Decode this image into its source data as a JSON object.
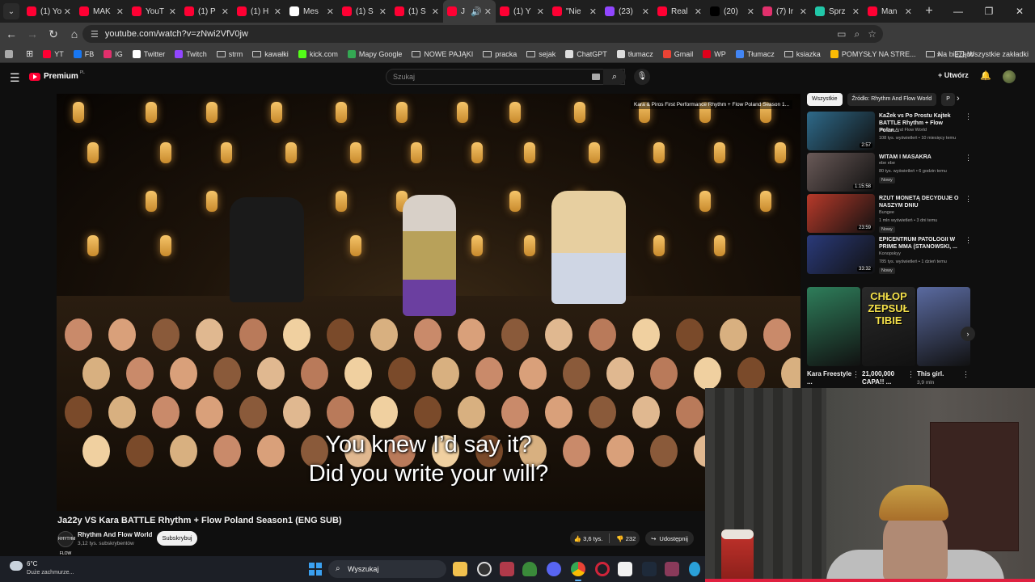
{
  "browser": {
    "tabs": [
      {
        "title": "(1) Yo",
        "color": "#ff0033"
      },
      {
        "title": "MAK",
        "color": "#ff0033"
      },
      {
        "title": "YouT",
        "color": "#ff0033"
      },
      {
        "title": "(1) P",
        "color": "#ff0033"
      },
      {
        "title": "(1) H",
        "color": "#ff0033"
      },
      {
        "title": "Mes",
        "color": "#ffffff"
      },
      {
        "title": "(1) S",
        "color": "#ff0033"
      },
      {
        "title": "(1) S",
        "color": "#ff0033"
      },
      {
        "title": "J",
        "color": "#ff0033",
        "active": true
      },
      {
        "title": "(1) Y",
        "color": "#ff0033"
      },
      {
        "title": "\"Nie",
        "color": "#ff0033"
      },
      {
        "title": "(23)",
        "color": "#9146ff"
      },
      {
        "title": "Real",
        "color": "#ff0033"
      },
      {
        "title": "(20)",
        "color": "#000000"
      },
      {
        "title": "(7) Ir",
        "color": "#e1306c"
      },
      {
        "title": "Sprz",
        "color": "#21c7a8"
      },
      {
        "title": "Man",
        "color": "#ff0033"
      }
    ],
    "url": "youtube.com/watch?v=zNwi2VfV0jw",
    "bookmarks": [
      {
        "label": "YT",
        "icon": "youtube-icon",
        "color": "#ff0033"
      },
      {
        "label": "FB",
        "icon": "facebook-icon",
        "color": "#1877f2"
      },
      {
        "label": "IG",
        "icon": "instagram-icon",
        "color": "#e1306c"
      },
      {
        "label": "Twitter",
        "icon": "x-icon",
        "color": "#ffffff"
      },
      {
        "label": "Twitch",
        "icon": "twitch-icon",
        "color": "#9146ff"
      },
      {
        "label": "strm",
        "icon": "folder-icon"
      },
      {
        "label": "kawałki",
        "icon": "folder-icon"
      },
      {
        "label": "kick.com",
        "icon": "kick-icon",
        "color": "#53fc18"
      },
      {
        "label": "Mapy Google",
        "icon": "maps-icon",
        "color": "#34a853"
      },
      {
        "label": "NOWE PAJĄKI",
        "icon": "folder-icon"
      },
      {
        "label": "pracka",
        "icon": "folder-icon"
      },
      {
        "label": "sejak",
        "icon": "folder-icon"
      },
      {
        "label": "ChatGPT",
        "icon": "chatgpt-icon",
        "color": "#dddddd"
      },
      {
        "label": "tłumacz",
        "icon": "translate-icon",
        "color": "#dddddd"
      },
      {
        "label": "Gmail",
        "icon": "gmail-icon",
        "color": "#ea4335"
      },
      {
        "label": "WP",
        "icon": "wp-icon",
        "color": "#e0001b"
      },
      {
        "label": "Tłumacz",
        "icon": "translate-icon",
        "color": "#4285f4"
      },
      {
        "label": "ksiazka",
        "icon": "folder-icon"
      },
      {
        "label": "POMYSŁY NA STRE...",
        "icon": "bookmark-icon",
        "color": "#fbbc04"
      },
      {
        "label": "Na bieżąco",
        "icon": "folder-icon"
      }
    ],
    "all_bookmarks": "Wszystkie zakładki"
  },
  "youtube": {
    "brand": "Premium",
    "brand_cc": "PL",
    "search_placeholder": "Szukaj",
    "create_label": "Utwórz",
    "video": {
      "subtitle_line1": "You knew I’d say it?",
      "subtitle_line2": "Did you write your will?",
      "corner_title": "Kara & Piros First Performance Rhythm + Flow Poland Season 1...",
      "title": "Ja22y VS Kara BATTLE Rhythm + Flow Poland Season1 (ENG SUB)",
      "channel": "Rhythm And Flow World",
      "channel_avatar_text": "RHYTHM FLOW",
      "subscribers": "3,12 tys. subskrybentów",
      "subscribe_label": "Subskrybuj",
      "likes": "3,6 tys.",
      "dislikes": "232",
      "share_label": "Udostępnij"
    },
    "chips": [
      {
        "label": "Wszystkie",
        "selected": true
      },
      {
        "label": "Źródło: Rhythm And Flow World",
        "selected": false
      },
      {
        "label": "P",
        "selected": false
      }
    ],
    "recommendations": [
      {
        "title": "KaŻek vs Po Prostu Kajtek BATTLE Rhythm + Flow Polan...",
        "channel": "Rhythm And Flow World",
        "meta": "108 tys. wyświetleń • 10 miesięcy temu",
        "duration": "2:57",
        "badge": "",
        "thumb": "#2e6a8a"
      },
      {
        "title": "WITAM I MASAKRA",
        "channel": "ebe ebe",
        "meta": "80 tys. wyświetleń • 6 godzin temu",
        "duration": "1:15:58",
        "badge": "Nowy",
        "thumb": "#6a5a58"
      },
      {
        "title": "RZUT MONETĄ DECYDUJE O NASZYM DNIU",
        "channel": "Bungee",
        "meta": "1 mln wyświetleń • 3 dni temu",
        "duration": "23:59",
        "badge": "Nowy",
        "thumb": "#b83a2a"
      },
      {
        "title": "EPICENTRUM PATOLOGII W PRIME MMA (STANOWSKI, ...",
        "channel": "Konopskyy",
        "meta": "785 tys. wyświetleń • 1 dzień temu",
        "duration": "33:32",
        "badge": "Nowy",
        "thumb": "#2a3a7a"
      }
    ],
    "shorts": [
      {
        "title": "Kara Freestyle ...",
        "views": "",
        "thumb": "#2e7d5a"
      },
      {
        "title": "21,000,000 CAPA!! ...",
        "views": "",
        "thumb": "#2a2a2a",
        "overlay": "CHŁOP ZEPSUŁ TIBIE"
      },
      {
        "title": "This girl.",
        "views": "3,9 mln",
        "thumb": "#5a6aa0"
      }
    ]
  },
  "taskbar": {
    "temp": "6°C",
    "weather": "Duże zachmurze...",
    "search_label": "Wyszukaj"
  }
}
